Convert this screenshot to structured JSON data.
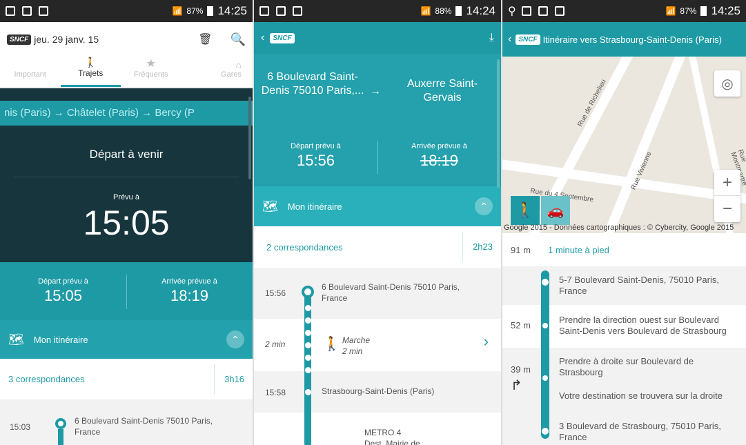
{
  "s1": {
    "status_time": "14:25",
    "battery": "87%",
    "date": "jeu. 29 janv. 15",
    "tabs": [
      {
        "label": "Important"
      },
      {
        "label": "Trajets",
        "active": true
      },
      {
        "label": "Fréquents"
      },
      {
        "label": "Gares"
      }
    ],
    "route_marquee": "nis (Paris)  →  Châtelet (Paris)  →  Bercy (P",
    "depart_title": "Départ à venir",
    "prevu_label": "Prévu à",
    "prevu_time": "15:05",
    "dep_label": "Départ prévu à",
    "dep_time": "15:05",
    "arr_label": "Arrivée prévue à",
    "arr_time": "18:19",
    "itinerary": "Mon itinéraire",
    "corr": "3 correspondances",
    "duration": "3h16",
    "stop_time": "15:03",
    "stop_addr": "6 Boulevard Saint-Denis 75010 Paris, France"
  },
  "s2": {
    "status_time": "14:24",
    "battery": "88%",
    "from": "6 Boulevard Saint-Denis 75010 Paris,...",
    "to": "Auxerre Saint-Gervais",
    "dep_label": "Départ prévu à",
    "dep_time": "15:56",
    "arr_label": "Arrivée prévue à",
    "arr_time": "18:19",
    "itinerary": "Mon itinéraire",
    "corr": "2 correspondances",
    "duration": "2h23",
    "stop1_time": "15:56",
    "stop1_addr": "6 Boulevard Saint-Denis 75010 Paris, France",
    "walk_time": "2 min",
    "walk_label": "Marche",
    "walk_sub": "2 min",
    "stop2_time": "15:58",
    "stop2_addr": "Strasbourg-Saint-Denis (Paris)",
    "metro": "METRO 4",
    "metro_dest": "Dest. Mairie de"
  },
  "s3": {
    "status_time": "14:25",
    "battery": "87%",
    "title": "Itinéraire vers Strasbourg-Saint-Denis (Paris)",
    "streets": [
      "Rue de Richelieu",
      "Rue Vivienne",
      "Rue du 4 Septembre",
      "Rue Montmartre"
    ],
    "map_credit": "Google 2015 - Données cartographiques : © Cybercity, Google 2015",
    "dist1": "91 m",
    "walk": "1 minute à pied",
    "steps": [
      {
        "dist": "",
        "text": "5-7 Boulevard Saint-Denis, 75010 Paris, France"
      },
      {
        "dist": "52 m",
        "text": "Prendre la direction ouest sur Boulevard Saint-Denis vers Boulevard de Strasbourg"
      },
      {
        "dist": "39 m",
        "text": "Prendre à droite sur Boulevard de Strasbourg",
        "sub": "Votre destination se trouvera sur la droite"
      },
      {
        "dist": "",
        "text": "3 Boulevard de Strasbourg, 75010 Paris, France"
      }
    ]
  },
  "logo": "SNCF"
}
